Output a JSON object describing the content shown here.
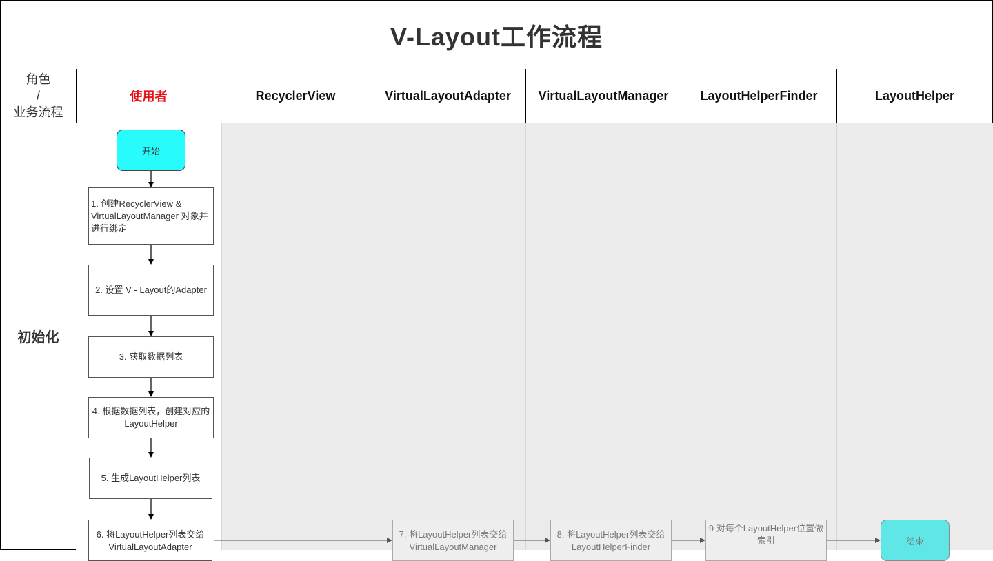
{
  "title": "V-Layout工作流程",
  "corner": {
    "line1": "角色",
    "line2": "/",
    "line3": "业务流程"
  },
  "lanes": [
    {
      "label": "使用者"
    },
    {
      "label": "RecyclerView"
    },
    {
      "label": "VirtualLayoutAdapter"
    },
    {
      "label": "VirtualLayoutManager"
    },
    {
      "label": "LayoutHelperFinder"
    },
    {
      "label": "LayoutHelper"
    }
  ],
  "phase": "初始化",
  "nodes": {
    "start": "开始",
    "step1": "1. 创建RecyclerView & VirtualLayoutManager 对象并进行绑定",
    "step2": "2. 设置 V - Layout的Adapter",
    "step3": "3. 获取数据列表",
    "step4": "4. 根据数据列表，创建对应的LayoutHelper",
    "step5": "5. 生成LayoutHelper列表",
    "step6": "6. 将LayoutHelper列表交给VirtualLayoutAdapter",
    "step7": "7. 将LayoutHelper列表交给VirtualLayoutManager",
    "step8": "8. 将LayoutHelper列表交给LayoutHelperFinder",
    "step9": "9 对每个LayoutHelper位置做索引",
    "end": "结束"
  },
  "colors": {
    "start_fill": "#27fbfb",
    "end_fill": "#5fe7e7",
    "user_lane_text": "#e8141b",
    "lane_bg": "#ebebeb"
  }
}
